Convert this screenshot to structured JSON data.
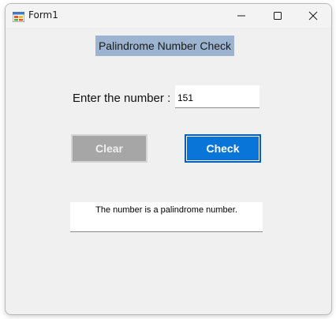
{
  "window": {
    "title": "Form1",
    "icon": "winforms-app-icon",
    "controls": {
      "minimize_icon": "minimize-icon",
      "maximize_icon": "maximize-icon",
      "close_icon": "close-icon"
    }
  },
  "form": {
    "header": "Palindrome Number Check",
    "prompt_label": "Enter the number :",
    "number_value": "151",
    "clear_label": "Clear",
    "check_label": "Check",
    "result_text": "The number is a palindrome number."
  },
  "colors": {
    "header_bg": "#9cb4cf",
    "check_button": "#0a75d8",
    "clear_button": "#a6a6a6",
    "form_bg": "#f0f0f0"
  }
}
